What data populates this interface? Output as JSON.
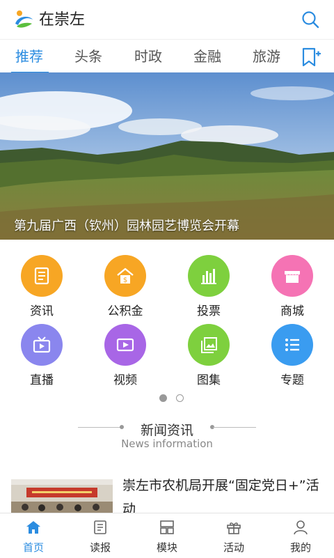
{
  "header": {
    "app_title": "在崇左",
    "logo_icon": "app-logo-icon",
    "search_icon": "search-icon"
  },
  "tabs": [
    {
      "label": "推荐",
      "active": true
    },
    {
      "label": "头条",
      "active": false
    },
    {
      "label": "时政",
      "active": false
    },
    {
      "label": "金融",
      "active": false
    },
    {
      "label": "旅游",
      "active": false
    }
  ],
  "banner": {
    "caption": "第九届广西（钦州）园林园艺博览会开幕",
    "page_index": 1,
    "page_count": 2
  },
  "grid": [
    {
      "label": "资讯",
      "icon": "news-icon",
      "color": "#f7a624"
    },
    {
      "label": "公积金",
      "icon": "housing-fund-icon",
      "color": "#f7a624"
    },
    {
      "label": "投票",
      "icon": "vote-chart-icon",
      "color": "#7ed03e"
    },
    {
      "label": "商城",
      "icon": "shop-icon",
      "color": "#f573b4"
    },
    {
      "label": "直播",
      "icon": "live-tv-icon",
      "color": "#8a86ee"
    },
    {
      "label": "视频",
      "icon": "video-icon",
      "color": "#a866e6"
    },
    {
      "label": "图集",
      "icon": "gallery-icon",
      "color": "#7ed03e"
    },
    {
      "label": "专题",
      "icon": "topic-list-icon",
      "color": "#3a9cf0"
    }
  ],
  "news_section": {
    "title": "新闻资讯",
    "subtitle": "News information"
  },
  "article": {
    "title": "崇左市农机局开展“固定党日+”活动"
  },
  "bottom_nav": [
    {
      "label": "首页",
      "icon": "home-icon",
      "active": true
    },
    {
      "label": "读报",
      "icon": "newspaper-icon",
      "active": false
    },
    {
      "label": "模块",
      "icon": "modules-icon",
      "active": false
    },
    {
      "label": "活动",
      "icon": "gift-icon",
      "active": false
    },
    {
      "label": "我的",
      "icon": "profile-icon",
      "active": false
    }
  ],
  "colors": {
    "accent": "#2b8ce0"
  }
}
